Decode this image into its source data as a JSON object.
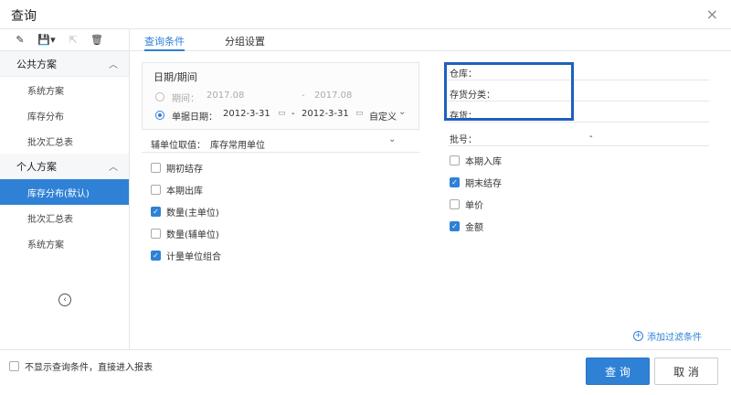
{
  "window": {
    "title": "查询",
    "close_glyph": "×"
  },
  "sidebar": {
    "toolbar": [
      {
        "icon": "edit-icon",
        "glyph": "✎",
        "disabled": false
      },
      {
        "icon": "save-icon",
        "glyph": "💾▾",
        "disabled": false
      },
      {
        "icon": "export-icon",
        "glyph": "⇱",
        "disabled": true
      },
      {
        "icon": "delete-icon",
        "glyph": "🗑",
        "disabled": false
      }
    ],
    "public_group": {
      "label": "公共方案",
      "items": [
        "系统方案",
        "库存分布",
        "批次汇总表"
      ]
    },
    "personal_group": {
      "label": "个人方案",
      "items": [
        "库存分布(默认)",
        "批次汇总表",
        "系统方案"
      ],
      "active_index": 0
    },
    "collapse_glyph": "‹"
  },
  "tabs": {
    "query_conditions": "查询条件",
    "group_settings": "分组设置"
  },
  "date_section": {
    "label": "日期/期间",
    "period_label": "期间：",
    "period_from": "2017.08",
    "period_to": "2017.08",
    "period_sep": "-",
    "doc_date_label": "单据日期：",
    "doc_date_from": "2012-3-31",
    "doc_date_to": "2012-3-31",
    "doc_date_sep": "-",
    "custom_label": "自定义",
    "calendar_glyph": "▭",
    "chevron_glyph": "⌄"
  },
  "aux_unit": {
    "label": "辅单位取值：",
    "value": "库存常用单位",
    "chevron_glyph": "⌄"
  },
  "left_checks": [
    {
      "label": "期初结存",
      "checked": false
    },
    {
      "label": "本期出库",
      "checked": false
    },
    {
      "label": "数量(主单位)",
      "checked": true
    },
    {
      "label": "数量(辅单位)",
      "checked": false
    },
    {
      "label": "计量单位组合",
      "checked": true
    }
  ],
  "right_fields": {
    "warehouse": "仓库：",
    "inventory_class": "存货分类：",
    "inventory": "存货：",
    "batch": "批号：",
    "batch_sep": "-"
  },
  "right_checks": [
    {
      "label": "本期入库",
      "checked": false
    },
    {
      "label": "期末结存",
      "checked": true
    },
    {
      "label": "单价",
      "checked": false
    },
    {
      "label": "金额",
      "checked": true
    }
  ],
  "add_filter": {
    "label": "添加过滤条件",
    "glyph": "+"
  },
  "footer": {
    "skip_label": "不显示查询条件，直接进入报表",
    "query_button": "查 询",
    "cancel_button": "取 消"
  },
  "colors": {
    "accent": "#2f81d6",
    "highlight_border": "#1f5fbf"
  }
}
